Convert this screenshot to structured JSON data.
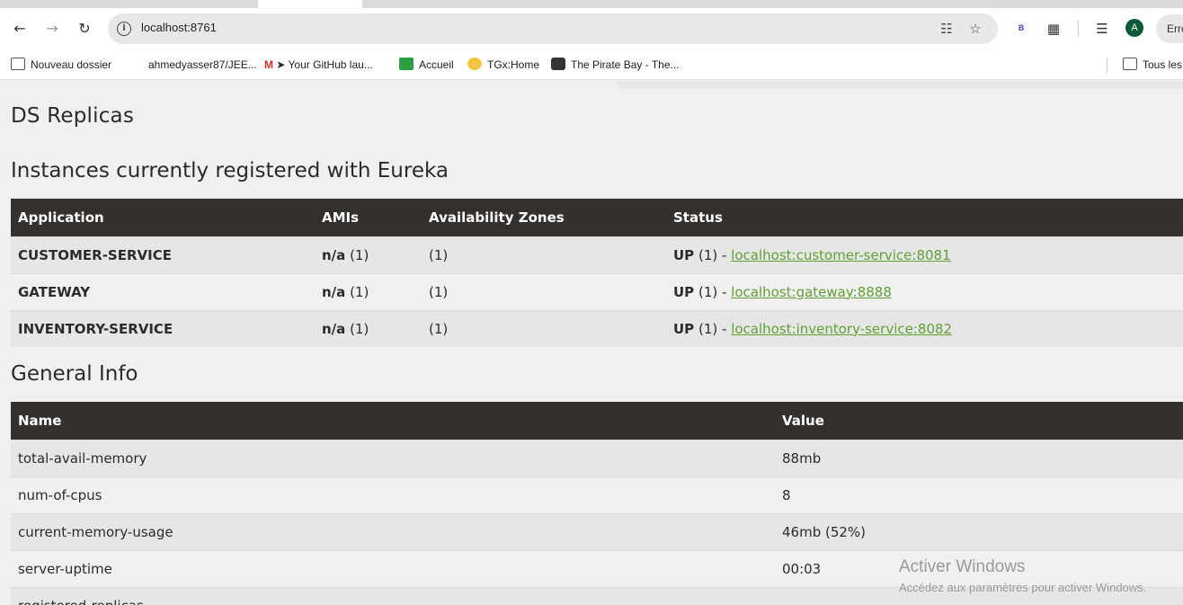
{
  "browser": {
    "url": "localhost:8761",
    "profile_initial": "A",
    "error_pill": "Erre",
    "extension_badge": "B"
  },
  "bookmarks": [
    {
      "label": "Nouveau dossier",
      "icon": "folder-icon"
    },
    {
      "label": "ahmedyasser87/JEE...",
      "icon": "github-icon"
    },
    {
      "label": "Your GitHub lau...",
      "icon": "gmail-rocket-icon"
    },
    {
      "label": "Accueil",
      "icon": "classroom-icon"
    },
    {
      "label": "TGx:Home",
      "icon": "tgx-icon"
    },
    {
      "label": "The Pirate Bay - The...",
      "icon": "pirate-icon"
    },
    {
      "label": "Tous les",
      "icon": "folder-icon"
    }
  ],
  "page": {
    "title": "DS Replicas",
    "instances_heading": "Instances currently registered with Eureka",
    "general_heading": "General Info"
  },
  "instances": {
    "headers": [
      "Application",
      "AMIs",
      "Availability Zones",
      "Status"
    ],
    "rows": [
      {
        "application": "CUSTOMER-SERVICE",
        "ami": "n/a",
        "ami_count": "(1)",
        "zones": "(1)",
        "status": "UP",
        "status_count": "(1) -",
        "link": "localhost:customer-service:8081"
      },
      {
        "application": "GATEWAY",
        "ami": "n/a",
        "ami_count": "(1)",
        "zones": "(1)",
        "status": "UP",
        "status_count": "(1) -",
        "link": "localhost:gateway:8888"
      },
      {
        "application": "INVENTORY-SERVICE",
        "ami": "n/a",
        "ami_count": "(1)",
        "zones": "(1)",
        "status": "UP",
        "status_count": "(1) -",
        "link": "localhost:inventory-service:8082"
      }
    ]
  },
  "general_info": {
    "headers": [
      "Name",
      "Value"
    ],
    "rows": [
      {
        "name": "total-avail-memory",
        "value": "88mb"
      },
      {
        "name": "num-of-cpus",
        "value": "8"
      },
      {
        "name": "current-memory-usage",
        "value": "46mb (52%)"
      },
      {
        "name": "server-uptime",
        "value": "00:03"
      },
      {
        "name": "registered-replicas",
        "value": ""
      }
    ]
  },
  "watermark": {
    "line1": "Activer Windows",
    "line2": "Accédez aux paramètres pour activer Windows."
  },
  "colors": {
    "header_bg": "#34302d",
    "link": "#5fa134",
    "page_bg": "#f0f0f0"
  }
}
